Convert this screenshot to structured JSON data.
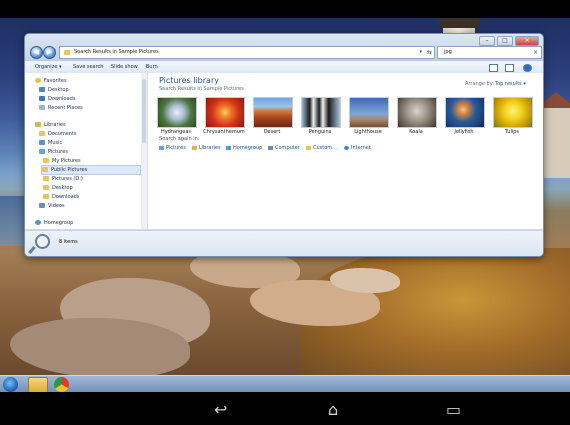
{
  "window": {
    "address": "Search Results in Sample Pictures",
    "search_value": "jpg"
  },
  "toolbar": {
    "organize": "Organize ▾",
    "save_search": "Save search",
    "slide_show": "Slide show",
    "burn": "Burn"
  },
  "nav": {
    "favorites": "Favorites",
    "desktop": "Desktop",
    "downloads": "Downloads",
    "recent": "Recent Places",
    "libraries": "Libraries",
    "documents": "Documents",
    "music": "Music",
    "pictures": "Pictures",
    "my_pictures": "My Pictures",
    "public_pictures": "Public Pictures",
    "pictures_d": "Pictures (D:)",
    "desktop2": "Desktop",
    "downloads2": "Downloads",
    "videos": "Videos",
    "homegroup": "Homegroup"
  },
  "content": {
    "title": "Pictures library",
    "subtitle": "Search Results in Sample Pictures",
    "arrange_label": "Arrange by:",
    "arrange_value": "Top results ▾",
    "search_again": "Search again in:",
    "search_targets": [
      "Pictures",
      "Libraries",
      "Homegroup",
      "Computer",
      "Custom...",
      "Internet"
    ],
    "items": [
      {
        "name": "Hydrangeas",
        "color": "#6a8f57"
      },
      {
        "name": "Chrysanthemum",
        "color": "#d84a1c"
      },
      {
        "name": "Desert",
        "color": "#b8502b"
      },
      {
        "name": "Penguins",
        "color": "#7b9cc2"
      },
      {
        "name": "Lighthouse",
        "color": "#5e82b6"
      },
      {
        "name": "Koala",
        "color": "#8f8a80"
      },
      {
        "name": "Jellyfish",
        "color": "#1f4f86"
      },
      {
        "name": "Tulips",
        "color": "#e0b812"
      }
    ]
  },
  "status": {
    "count": "8 items"
  }
}
